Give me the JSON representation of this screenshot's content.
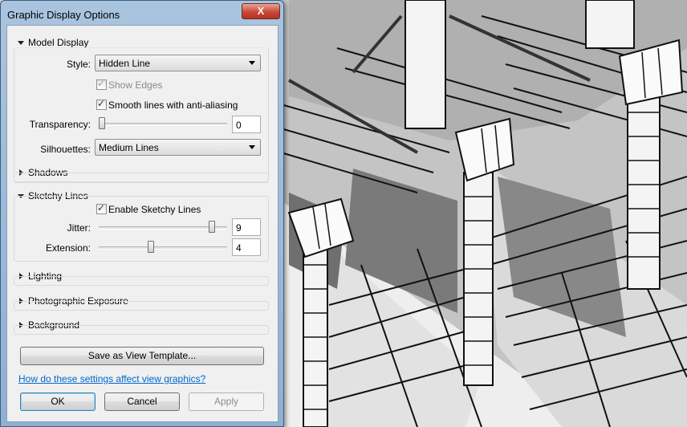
{
  "window": {
    "title": "Graphic Display Options",
    "close_glyph": "X"
  },
  "model_display": {
    "header": "Model Display",
    "style_label": "Style:",
    "style_value": "Hidden Line",
    "show_edges_label": "Show Edges",
    "show_edges_checked": true,
    "show_edges_enabled": false,
    "smooth_lines_label": "Smooth lines with anti-aliasing",
    "smooth_lines_checked": true,
    "transparency_label": "Transparency:",
    "transparency_value": "0",
    "transparency_level": 0,
    "silhouettes_label": "Silhouettes:",
    "silhouettes_value": "Medium Lines"
  },
  "shadows": {
    "header": "Shadows"
  },
  "sketchy_lines": {
    "header": "Sketchy Lines",
    "enable_label": "Enable Sketchy Lines",
    "enable_checked": true,
    "jitter_label": "Jitter:",
    "jitter_value": "9",
    "jitter_level": 0.9,
    "extension_label": "Extension:",
    "extension_value": "4",
    "extension_level": 0.4
  },
  "lighting": {
    "header": "Lighting"
  },
  "photographic_exposure": {
    "header": "Photographic Exposure"
  },
  "background": {
    "header": "Background"
  },
  "save_template_label": "Save as View Template...",
  "help_link": "How do these settings affect view graphics?",
  "buttons": {
    "ok": "OK",
    "cancel": "Cancel",
    "apply": "Apply"
  },
  "colors": {
    "accent": "#3c7fb1",
    "link": "#0066cc",
    "close": "#c9483a"
  }
}
